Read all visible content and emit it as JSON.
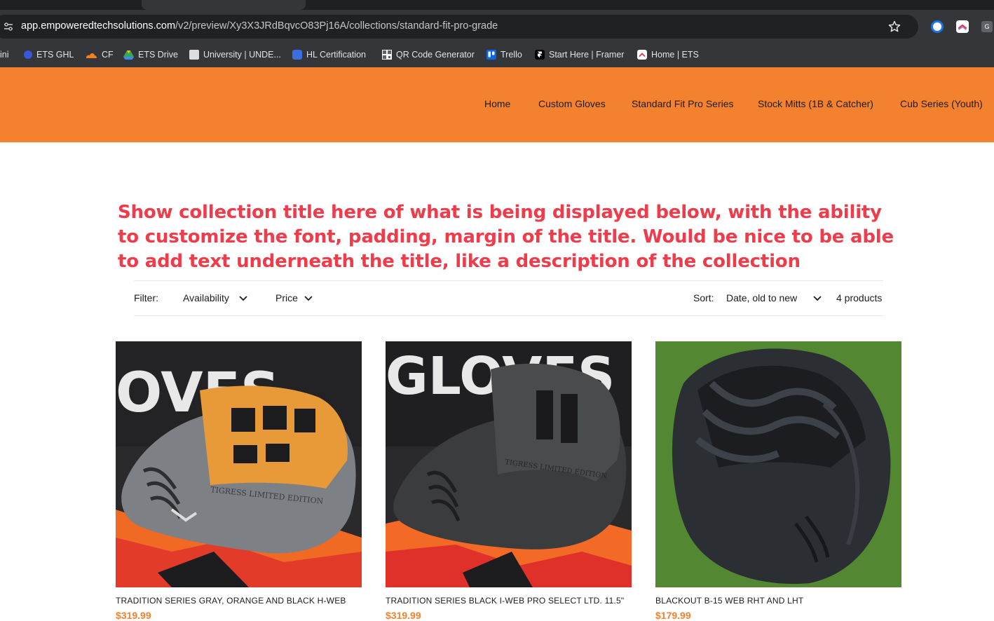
{
  "browser": {
    "url_host": "app.empoweredtechsolutions.com",
    "url_path": "/v2/preview/Xy3X3JRdBqvcO83Pj16A/collections/standard-fit-pro-grade",
    "extension_g": "G",
    "bookmarks": [
      {
        "label": "ini",
        "icon": "none",
        "color": "#35363a"
      },
      {
        "label": "ETS GHL",
        "icon": "ghl-icon",
        "color": "#3b57d9"
      },
      {
        "label": "CF",
        "icon": "cloudflare-icon",
        "color": "#f48120"
      },
      {
        "label": "ETS Drive",
        "icon": "google-drive-icon",
        "color": "#34a853"
      },
      {
        "label": "University | UNDE...",
        "icon": "university-icon",
        "color": "#dddddd"
      },
      {
        "label": "HL Certification",
        "icon": "hl-certification-icon",
        "color": "#3b6fe0"
      },
      {
        "label": "QR Code Generator",
        "icon": "qr-code-icon",
        "color": "#9aa0a6"
      },
      {
        "label": "Trello",
        "icon": "trello-icon",
        "color": "#0c66e4"
      },
      {
        "label": "Start Here | Framer",
        "icon": "framer-icon",
        "color": "#000000"
      },
      {
        "label": "Home | ETS",
        "icon": "ets-icon",
        "color": "#ffffff"
      }
    ]
  },
  "header": {
    "bg_color": "#f4812e",
    "nav": [
      {
        "label": "Home"
      },
      {
        "label": "Custom Gloves"
      },
      {
        "label": "Standard Fit Pro Series"
      },
      {
        "label": "Stock Mitts (1B & Catcher)"
      },
      {
        "label": "Cub Series (Youth)"
      }
    ]
  },
  "annotation": {
    "text": "Show collection title here of what is being displayed below, with the ability to customize the font, padding, margin of the title. Would be nice to be able to add text underneath the title, like a description of the collection",
    "color": "#ef3b4a"
  },
  "filter_bar": {
    "filter_label": "Filter:",
    "availability_label": "Availability",
    "price_label": "Price",
    "sort_label": "Sort:",
    "sort_value": "Date, old to new",
    "product_count": "4 products"
  },
  "products": [
    {
      "title": "TRADITION SERIES GRAY, ORANGE AND BLACK H-WEB",
      "price": "$319.99",
      "image": "gray-orange-black-h-web-glove"
    },
    {
      "title": "TRADITION SERIES BLACK I-WEB PRO SELECT LTD. 11.5\"",
      "price": "$319.99",
      "image": "black-i-web-glove"
    },
    {
      "title": "BLACKOUT B-15 WEB RHT AND LHT",
      "price": "$179.99",
      "image": "blackout-b15-web-glove"
    }
  ],
  "colors": {
    "accent": "#f4812e",
    "price": "#f4812e",
    "text": "#1c1c1c"
  }
}
